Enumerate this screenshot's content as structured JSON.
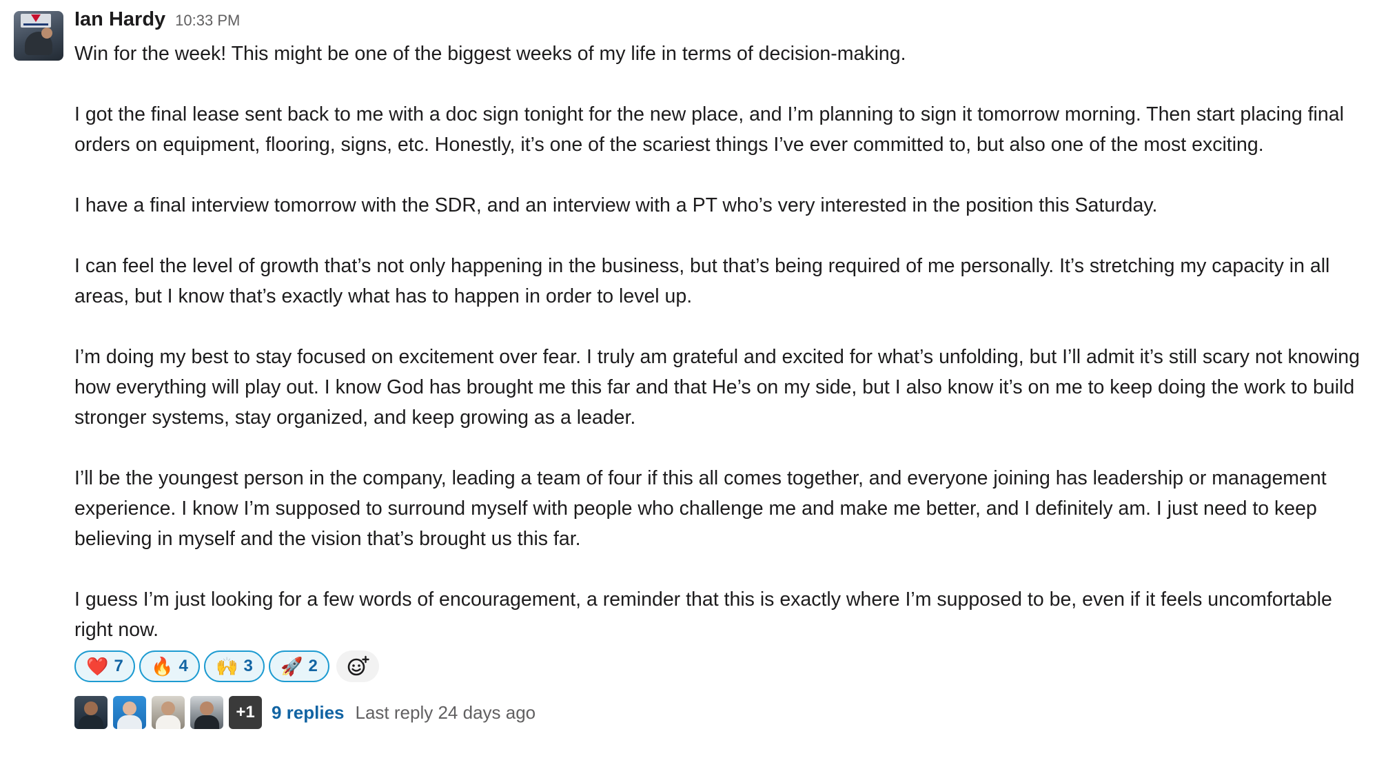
{
  "message": {
    "sender": "Ian Hardy",
    "timestamp": "10:33 PM",
    "paragraphs": [
      "Win for the week! This might be one of the biggest weeks of my life in terms of decision-making.",
      "I got the final lease sent back to me with a doc sign tonight for the new place, and I’m planning to sign it tomorrow morning. Then start placing final orders on equipment, flooring, signs, etc. Honestly, it’s one of the scariest things I’ve ever committed to, but also one of the most exciting.",
      "I have a final interview tomorrow with the SDR, and an interview with a PT who’s very interested in the position this Saturday.",
      "I can feel the level of growth that’s not only happening in the business, but that’s being required of me personally. It’s stretching my capacity in all areas, but I know that’s exactly what has to happen in order to level up.",
      "I’m doing my best to stay focused on excitement over fear. I truly am grateful and excited for what’s unfolding, but I’ll admit it’s still scary not knowing how everything will play out. I know God has brought me this far and that He’s on my side, but I also know it’s on me to keep doing the work to build stronger systems, stay organized, and keep growing as a leader.",
      "I’ll be the youngest person in the company, leading a team of four if this all comes together, and everyone joining has leadership or management experience. I know I’m supposed to surround myself with people who challenge me and make me better, and I definitely am. I just need to keep believing in myself and the vision that’s brought us this far.",
      "I guess I’m just looking for a few words of encouragement, a reminder that this is exactly where I’m supposed to be, even if it feels uncomfortable right now."
    ]
  },
  "reactions": [
    {
      "emoji": "❤️",
      "name": "heart",
      "count": "7"
    },
    {
      "emoji": "🔥",
      "name": "fire",
      "count": "4"
    },
    {
      "emoji": "🙌",
      "name": "raised-hands",
      "count": "3"
    },
    {
      "emoji": "🚀",
      "name": "rocket",
      "count": "2"
    }
  ],
  "add_reaction_icon": "add-reaction-icon",
  "thread": {
    "extra_participants": "+1",
    "replies_label": "9 replies",
    "last_reply": "Last reply 24 days ago"
  },
  "colors": {
    "link": "#1264a3",
    "reaction_border": "#1d9bd1",
    "reaction_bg": "#e8f5fa",
    "muted_text": "#616061"
  }
}
